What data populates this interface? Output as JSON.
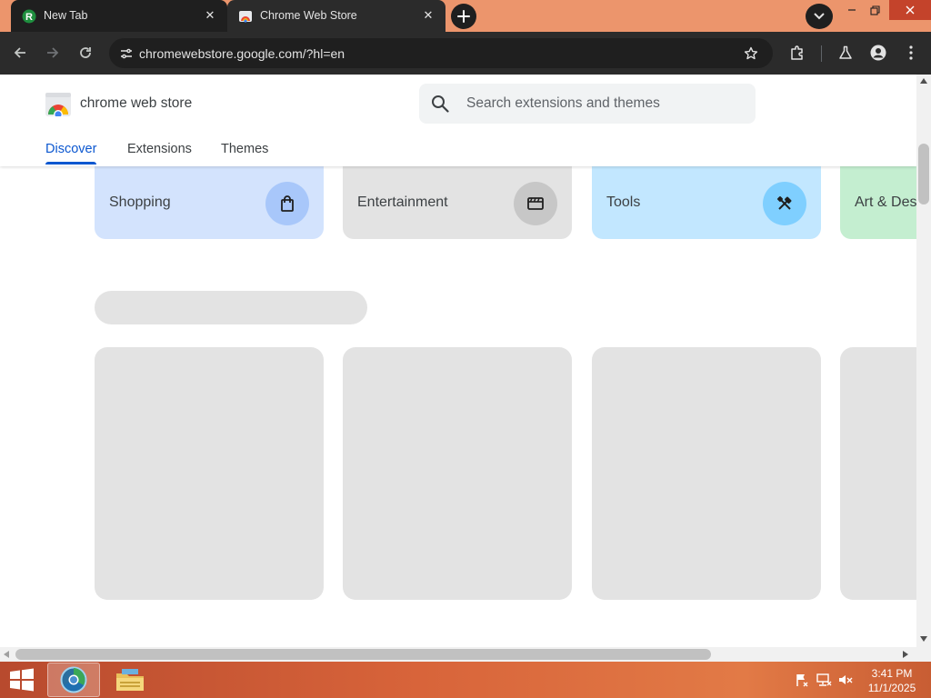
{
  "browser": {
    "tabs": [
      {
        "title": "New Tab",
        "active": false
      },
      {
        "title": "Chrome Web Store",
        "active": true
      }
    ],
    "url": "chromewebstore.google.com/?hl=en"
  },
  "store": {
    "name": "chrome web store",
    "search_placeholder": "Search extensions and themes",
    "nav": [
      {
        "label": "Discover",
        "active": true
      },
      {
        "label": "Extensions",
        "active": false
      },
      {
        "label": "Themes",
        "active": false
      }
    ],
    "categories": [
      {
        "label": "Shopping",
        "icon": "shopping-bag-icon",
        "card_color": "#d3e3fd",
        "icon_bg": "#a8c7fa"
      },
      {
        "label": "Entertainment",
        "icon": "clapperboard-icon",
        "card_color": "#e3e3e3",
        "icon_bg": "#c7c7c7"
      },
      {
        "label": "Tools",
        "icon": "tools-icon",
        "card_color": "#c2e7ff",
        "icon_bg": "#7fcfff"
      },
      {
        "label": "Art & Design",
        "icon": "palette-icon",
        "card_color": "#c4eed0",
        "icon_bg": "#6dd58c"
      }
    ]
  },
  "taskbar": {
    "time": "3:41 PM",
    "date": "11/1/2025"
  }
}
